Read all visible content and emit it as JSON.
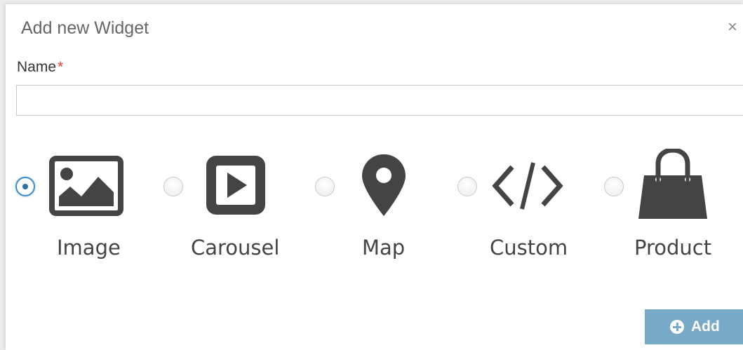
{
  "dialog": {
    "title": "Add new Widget",
    "close_symbol": "×"
  },
  "form": {
    "name_label": "Name",
    "required_marker": "*",
    "name_value": "",
    "name_placeholder": ""
  },
  "widget_types": [
    {
      "label": "Image",
      "icon": "image-icon",
      "selected": true
    },
    {
      "label": "Carousel",
      "icon": "carousel-icon",
      "selected": false
    },
    {
      "label": "Map",
      "icon": "map-pin-icon",
      "selected": false
    },
    {
      "label": "Custom",
      "icon": "code-icon",
      "selected": false
    },
    {
      "label": "Product",
      "icon": "shopping-bag-icon",
      "selected": false
    }
  ],
  "actions": {
    "add_label": "Add"
  },
  "colors": {
    "icon": "#444444",
    "primary_button": "#78a9c6",
    "radio_selected": "#3a8bc8",
    "required": "#e33b3b"
  }
}
